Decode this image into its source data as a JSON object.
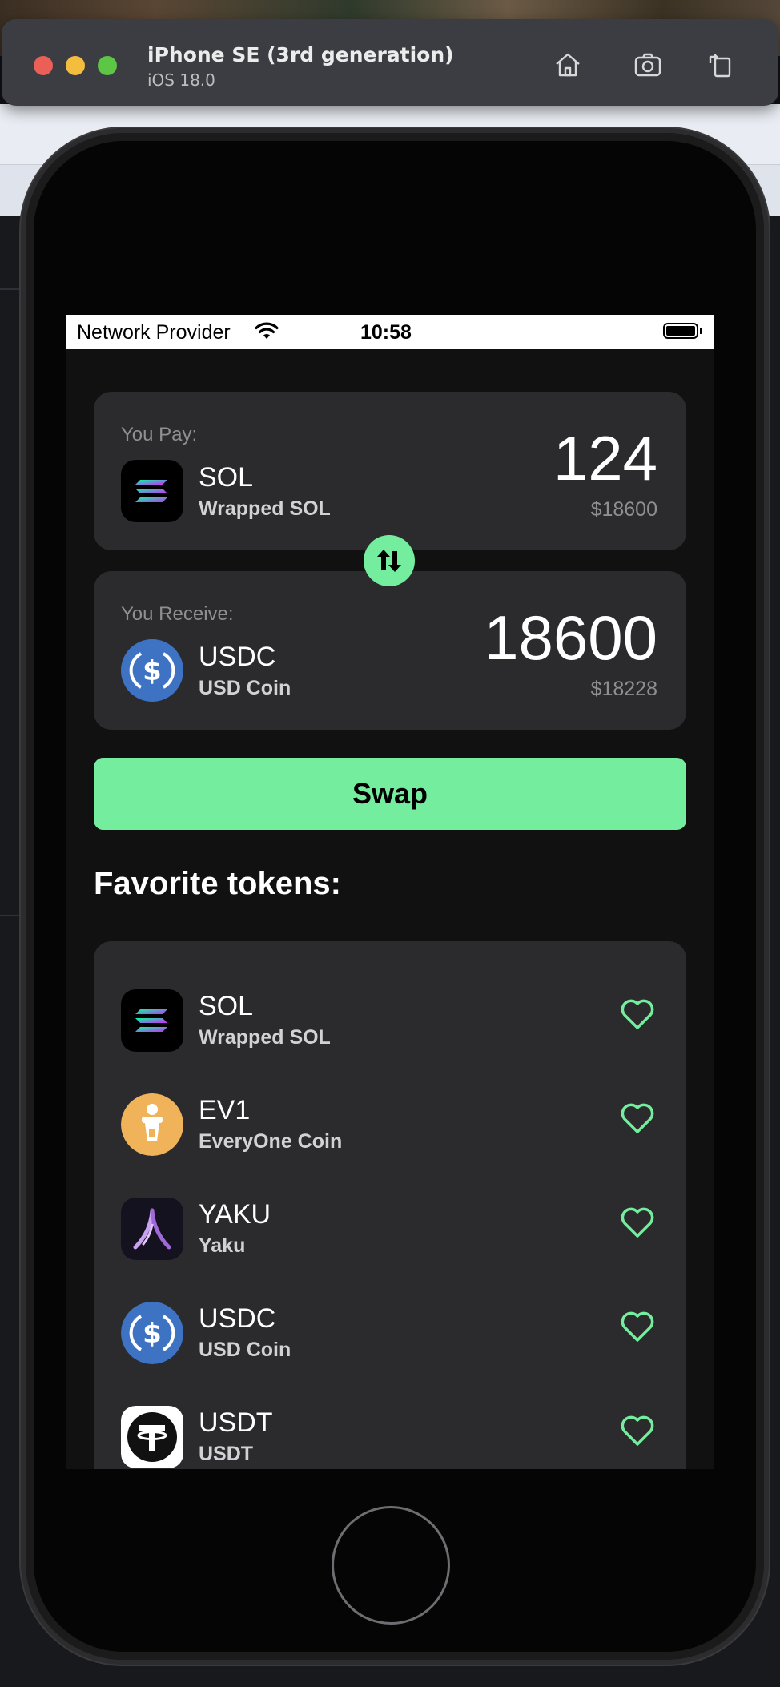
{
  "simulator": {
    "title": "iPhone SE (3rd generation)",
    "subtitle": "iOS 18.0",
    "toolbar_icons": [
      "home-icon",
      "screenshot-icon",
      "rotate-icon"
    ]
  },
  "status_bar": {
    "carrier": "Network Provider",
    "time": "10:58"
  },
  "swap": {
    "pay": {
      "label": "You Pay:",
      "symbol": "SOL",
      "name": "Wrapped SOL",
      "amount": "124",
      "usd": "$18600"
    },
    "receive": {
      "label": "You Receive:",
      "symbol": "USDC",
      "name": "USD Coin",
      "amount": "18600",
      "usd": "$18228"
    },
    "button_label": "Swap"
  },
  "favorites": {
    "title": "Favorite tokens:",
    "tokens": [
      {
        "symbol": "SOL",
        "name": "Wrapped SOL",
        "icon": "solana-icon"
      },
      {
        "symbol": "EV1",
        "name": "EveryOne Coin",
        "icon": "everyone-coin-icon"
      },
      {
        "symbol": "YAKU",
        "name": "Yaku",
        "icon": "yaku-icon"
      },
      {
        "symbol": "USDC",
        "name": "USD Coin",
        "icon": "usdc-icon"
      },
      {
        "symbol": "USDT",
        "name": "USDT",
        "icon": "tether-icon"
      }
    ]
  },
  "colors": {
    "accent": "#74ee9e",
    "card": "#2b2b2d",
    "screen_bg": "#111111"
  }
}
